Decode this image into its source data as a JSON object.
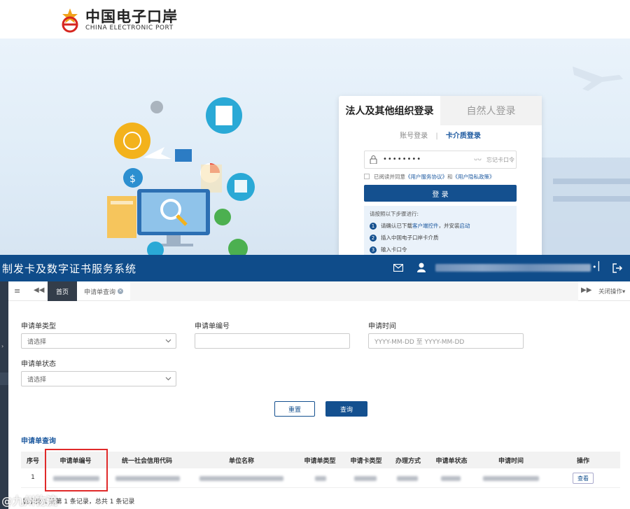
{
  "login_page": {
    "logo": {
      "title": "中国电子口岸",
      "subtitle": "CHINA ELECTRONIC PORT"
    },
    "tabs": {
      "active": "法人及其他组织登录",
      "inactive": "自然人登录"
    },
    "login_modes": {
      "account": "账号登录",
      "separator": "|",
      "card": "卡介质登录"
    },
    "password": {
      "value": "••••••••",
      "forgot": "忘记卡口令"
    },
    "agreement": {
      "prefix": "已阅读并同意",
      "terms": "《用户服务协议》",
      "and": "和",
      "privacy": "《用户隐私政策》"
    },
    "login_button": "登 录",
    "steps": {
      "heading": "请按照以下步骤进行:",
      "items": [
        {
          "num": "1",
          "text_before": "请确认已下载",
          "link1": "客户端控件",
          "text_mid": "，并安装",
          "link2": "启动"
        },
        {
          "num": "2",
          "text": "插入中国电子口岸卡介质"
        },
        {
          "num": "3",
          "text": "输入卡口令"
        }
      ]
    }
  },
  "system": {
    "title": "制发卡及数字证书服务系统",
    "header_icons": [
      "mail-icon",
      "user-icon",
      "logout-icon"
    ],
    "user_dot": "•",
    "user_sep": "|",
    "tabbar": {
      "menu_icon": "≡",
      "prev_icon": "◀◀",
      "home": "首页",
      "current_tab": "申请单查询",
      "close_x": "×",
      "next_icon": "▶▶",
      "close_ops": "关闭操作▾"
    },
    "form": {
      "type_label": "申请单类型",
      "type_value": "请选择",
      "number_label": "申请单编号",
      "number_value": "",
      "time_label": "申请时间",
      "time_placeholder": "YYYY-MM-DD 至 YYYY-MM-DD",
      "status_label": "申请单状态",
      "status_value": "请选择"
    },
    "buttons": {
      "reset": "重置",
      "query": "查询"
    },
    "section_title": "申请单查询",
    "table": {
      "headers": [
        "序号",
        "申请单编号",
        "统一社会信用代码",
        "单位名称",
        "申请单类型",
        "申请卡类型",
        "办理方式",
        "申请单状态",
        "申请时间",
        "操作"
      ],
      "rows": [
        {
          "index": "1",
          "action": "查看"
        }
      ]
    },
    "pager": "显示第 1 到第 1 条记录，总共 1 条记录",
    "watermark": "@九州物流"
  },
  "colors": {
    "brand_blue": "#0f4c8a",
    "accent_blue": "#1e5aa0",
    "highlight_red": "#e02a2a"
  }
}
